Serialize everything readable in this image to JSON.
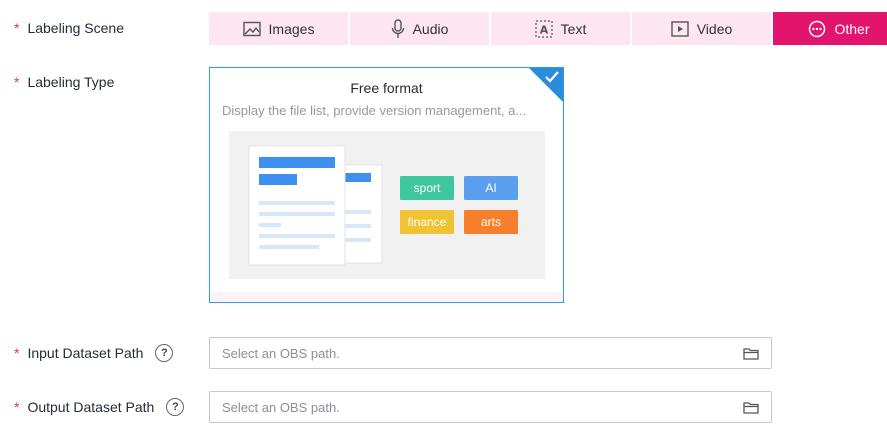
{
  "labels": {
    "required_mark": "*",
    "scene": "Labeling Scene",
    "type": "Labeling Type",
    "input_path": "Input Dataset Path",
    "output_path": "Output Dataset Path",
    "help_glyph": "?"
  },
  "scene_tabs": [
    {
      "label": "Images",
      "icon": "image-icon",
      "active": false
    },
    {
      "label": "Audio",
      "icon": "microphone-icon",
      "active": false
    },
    {
      "label": "Text",
      "icon": "text-icon",
      "active": false
    },
    {
      "label": "Video",
      "icon": "video-play-icon",
      "active": false
    },
    {
      "label": "Other",
      "icon": "ellipsis-circle-icon",
      "active": true
    }
  ],
  "type_card": {
    "title": "Free format",
    "description": "Display the file list, provide version management, a...",
    "selected": true,
    "chips": [
      {
        "label": "sport",
        "color": "#3fc8a0"
      },
      {
        "label": "AI",
        "color": "#5aa0ee"
      },
      {
        "label": "finance",
        "color": "#f1c232"
      },
      {
        "label": "arts",
        "color": "#f57f2a"
      }
    ]
  },
  "input_dataset": {
    "placeholder": "Select an OBS path.",
    "icon": "folder-icon"
  },
  "output_dataset": {
    "placeholder": "Select an OBS path.",
    "icon": "folder-icon"
  },
  "colors": {
    "accent": "#e3146d",
    "tab_bg": "#fde6ef",
    "selected_border": "#2ba0d7",
    "required": "#e0364f"
  }
}
